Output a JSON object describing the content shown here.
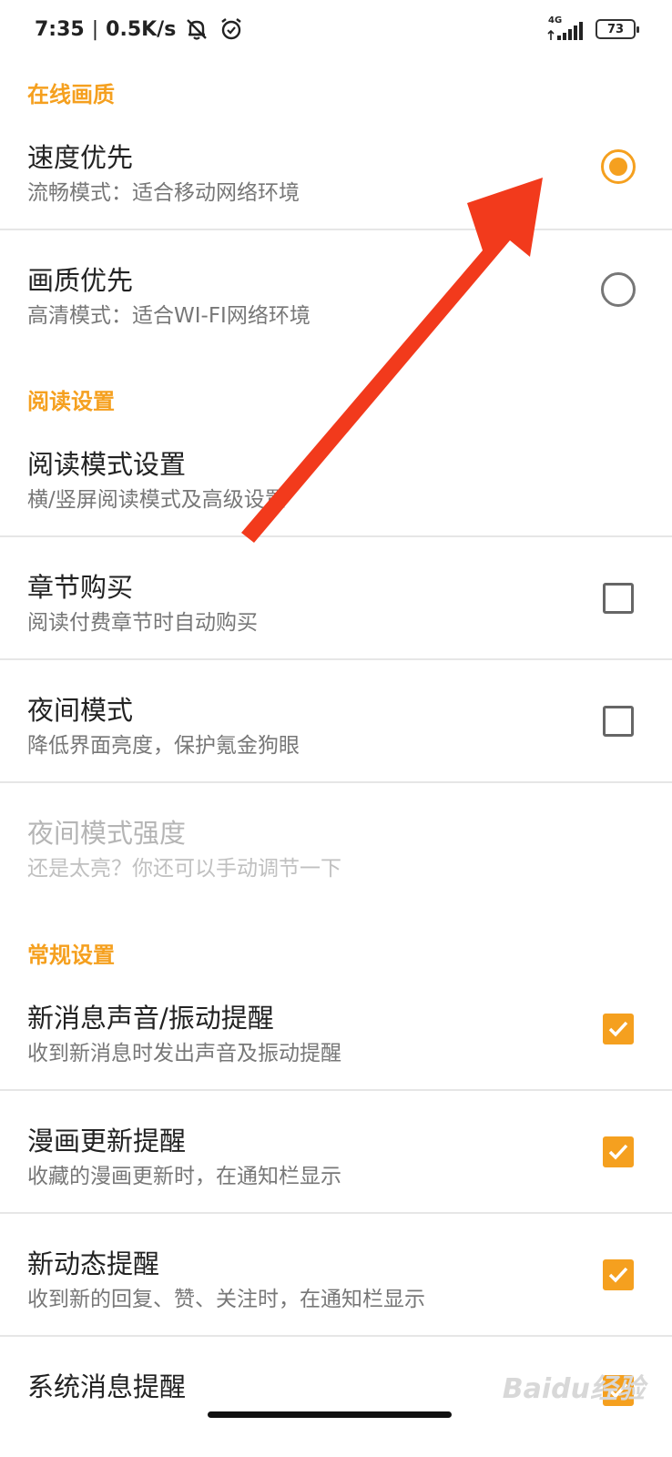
{
  "status_bar": {
    "time": "7:35",
    "separator": "|",
    "speed": "0.5K/s",
    "network": "4G",
    "battery": "73"
  },
  "sections": {
    "online_quality": {
      "header": "在线画质",
      "items": [
        {
          "title": "速度优先",
          "subtitle": "流畅模式：适合移动网络环境",
          "control": "radio",
          "selected": true
        },
        {
          "title": "画质优先",
          "subtitle": "高清模式：适合WI-FI网络环境",
          "control": "radio",
          "selected": false
        }
      ]
    },
    "reading": {
      "header": "阅读设置",
      "items": [
        {
          "title": "阅读模式设置",
          "subtitle": "横/竖屏阅读模式及高级设置"
        },
        {
          "title": "章节购买",
          "subtitle": "阅读付费章节时自动购买",
          "control": "checkbox",
          "checked": false
        },
        {
          "title": "夜间模式",
          "subtitle": "降低界面亮度，保护氪金狗眼",
          "control": "checkbox",
          "checked": false
        },
        {
          "title": "夜间模式强度",
          "subtitle": "还是太亮？你还可以手动调节一下",
          "disabled": true
        }
      ]
    },
    "general": {
      "header": "常规设置",
      "items": [
        {
          "title": "新消息声音/振动提醒",
          "subtitle": "收到新消息时发出声音及振动提醒",
          "control": "checkbox",
          "checked": true
        },
        {
          "title": "漫画更新提醒",
          "subtitle": "收藏的漫画更新时，在通知栏显示",
          "control": "checkbox",
          "checked": true
        },
        {
          "title": "新动态提醒",
          "subtitle": "收到新的回复、赞、关注时，在通知栏显示",
          "control": "checkbox",
          "checked": true
        },
        {
          "title": "系统消息提醒",
          "control": "checkbox",
          "checked": true
        }
      ]
    }
  },
  "watermark": "Baidu经验",
  "colors": {
    "accent": "#f5a01f",
    "arrow": "#f23a1c",
    "title": "#222222",
    "subtitle": "#777777",
    "disabled": "#b5b5b5"
  },
  "icons": {
    "mute": "bell-off-icon",
    "alarm": "alarm-icon",
    "signal": "signal-icon",
    "battery": "battery-icon",
    "annotation": "red-arrow-icon"
  }
}
